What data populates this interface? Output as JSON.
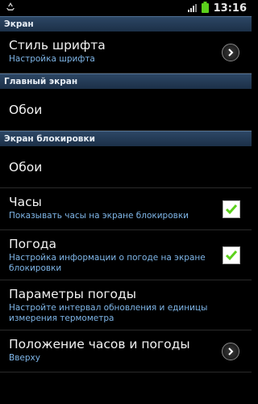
{
  "status_bar": {
    "time": "13:16",
    "left_icon": "recycle-icon",
    "right_icons": [
      "signal-icon",
      "battery-icon"
    ]
  },
  "sections": [
    {
      "header": "Экран",
      "items": [
        {
          "title": "Стиль шрифта",
          "subtitle": "Настройка шрифта",
          "control": "chevron"
        }
      ]
    },
    {
      "header": "Главный экран",
      "items": [
        {
          "title": "Обои"
        }
      ]
    },
    {
      "header": "Экран блокировки",
      "items": [
        {
          "title": "Обои"
        },
        {
          "title": "Часы",
          "subtitle": "Показывать часы на экране блокировки",
          "control": "checkbox",
          "checked": true
        },
        {
          "title": "Погода",
          "subtitle": "Настройка информации о погоде на экране блокировки",
          "control": "checkbox",
          "checked": true
        },
        {
          "title": "Параметры погоды",
          "subtitle": "Настройте интервал обновления и единицы измерения термометра"
        },
        {
          "title": "Положение часов и погоды",
          "subtitle": "Вверху",
          "control": "chevron"
        }
      ]
    }
  ],
  "colors": {
    "section_bg": "#1f3550",
    "subtitle": "#7fb6e8",
    "check": "#5cd11c"
  }
}
